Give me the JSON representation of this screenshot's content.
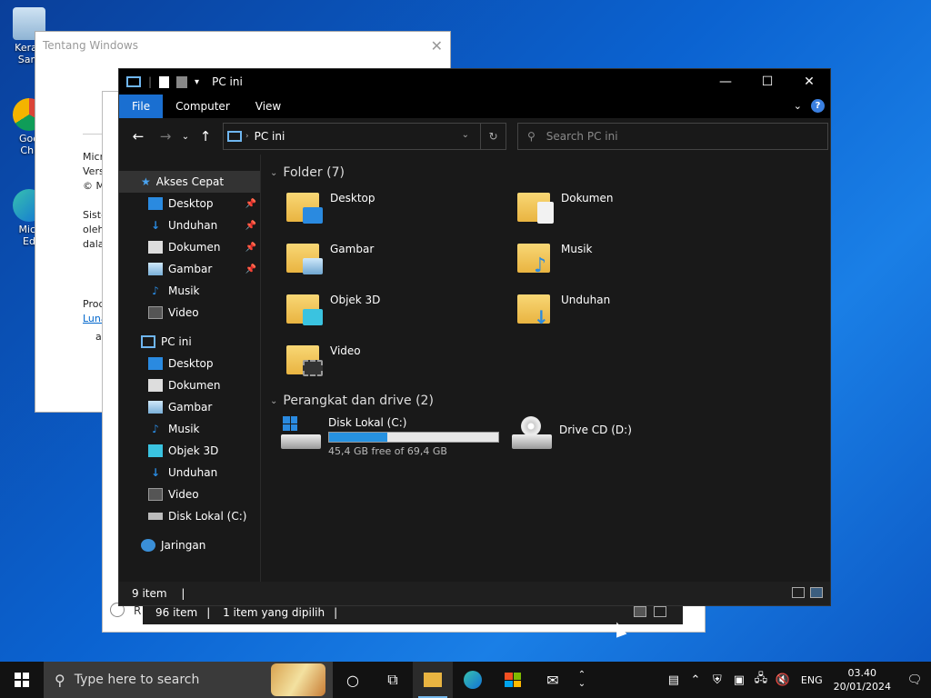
{
  "desktop": {
    "icons": [
      {
        "label": "Keran\nSam",
        "name": "recycle-bin"
      },
      {
        "label": "Goo\nChr",
        "name": "chrome"
      },
      {
        "label": "Micr\nEd",
        "name": "edge"
      }
    ]
  },
  "about_window": {
    "title": "Tentang Windows",
    "lines": [
      "Micr",
      "Vers",
      "© M",
      "",
      "Siste",
      "oleh",
      "dala",
      "",
      "Prod",
      "Luna",
      "a"
    ]
  },
  "mid_window": {
    "status_items": "96 item",
    "status_selected": "1 item yang dipilih",
    "r_label": "R"
  },
  "explorer": {
    "title": "PC ini",
    "ribbon_tabs": [
      "File",
      "Computer",
      "View"
    ],
    "address": "PC ini",
    "search_placeholder": "Search PC ini",
    "nav": {
      "quick_access": "Akses Cepat",
      "quick_items": [
        "Desktop",
        "Unduhan",
        "Dokumen",
        "Gambar",
        "Musik",
        "Video"
      ],
      "this_pc": "PC ini",
      "pc_items": [
        "Desktop",
        "Dokumen",
        "Gambar",
        "Musik",
        "Objek 3D",
        "Unduhan",
        "Video",
        "Disk Lokal (C:)"
      ],
      "network": "Jaringan"
    },
    "folders_header": "Folder (7)",
    "folders": [
      "Desktop",
      "Dokumen",
      "Gambar",
      "Musik",
      "Objek 3D",
      "Unduhan",
      "Video"
    ],
    "drives_header": "Perangkat dan drive (2)",
    "drive_c": {
      "name": "Disk Lokal (C:)",
      "free": "45,4 GB free of 69,4 GB",
      "used_fraction": 0.346
    },
    "drive_d": {
      "name": "Drive CD (D:)"
    },
    "status": "9 item"
  },
  "taskbar": {
    "search_placeholder": "Type here to search",
    "lang": "ENG",
    "time": "03.40",
    "date": "20/01/2024"
  }
}
